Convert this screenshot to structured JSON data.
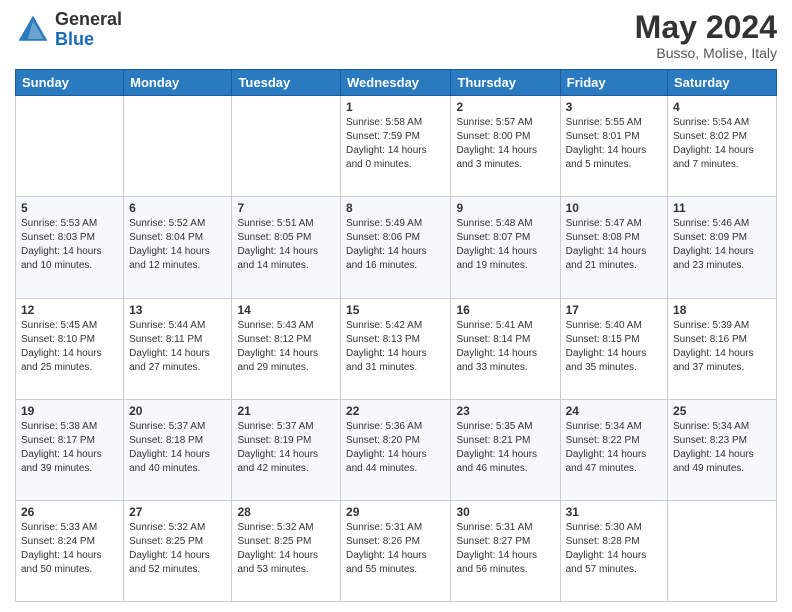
{
  "logo": {
    "general": "General",
    "blue": "Blue"
  },
  "header": {
    "month": "May 2024",
    "location": "Busso, Molise, Italy"
  },
  "days_of_week": [
    "Sunday",
    "Monday",
    "Tuesday",
    "Wednesday",
    "Thursday",
    "Friday",
    "Saturday"
  ],
  "weeks": [
    [
      {
        "day": "",
        "info": ""
      },
      {
        "day": "",
        "info": ""
      },
      {
        "day": "",
        "info": ""
      },
      {
        "day": "1",
        "info": "Sunrise: 5:58 AM\nSunset: 7:59 PM\nDaylight: 14 hours\nand 0 minutes."
      },
      {
        "day": "2",
        "info": "Sunrise: 5:57 AM\nSunset: 8:00 PM\nDaylight: 14 hours\nand 3 minutes."
      },
      {
        "day": "3",
        "info": "Sunrise: 5:55 AM\nSunset: 8:01 PM\nDaylight: 14 hours\nand 5 minutes."
      },
      {
        "day": "4",
        "info": "Sunrise: 5:54 AM\nSunset: 8:02 PM\nDaylight: 14 hours\nand 7 minutes."
      }
    ],
    [
      {
        "day": "5",
        "info": "Sunrise: 5:53 AM\nSunset: 8:03 PM\nDaylight: 14 hours\nand 10 minutes."
      },
      {
        "day": "6",
        "info": "Sunrise: 5:52 AM\nSunset: 8:04 PM\nDaylight: 14 hours\nand 12 minutes."
      },
      {
        "day": "7",
        "info": "Sunrise: 5:51 AM\nSunset: 8:05 PM\nDaylight: 14 hours\nand 14 minutes."
      },
      {
        "day": "8",
        "info": "Sunrise: 5:49 AM\nSunset: 8:06 PM\nDaylight: 14 hours\nand 16 minutes."
      },
      {
        "day": "9",
        "info": "Sunrise: 5:48 AM\nSunset: 8:07 PM\nDaylight: 14 hours\nand 19 minutes."
      },
      {
        "day": "10",
        "info": "Sunrise: 5:47 AM\nSunset: 8:08 PM\nDaylight: 14 hours\nand 21 minutes."
      },
      {
        "day": "11",
        "info": "Sunrise: 5:46 AM\nSunset: 8:09 PM\nDaylight: 14 hours\nand 23 minutes."
      }
    ],
    [
      {
        "day": "12",
        "info": "Sunrise: 5:45 AM\nSunset: 8:10 PM\nDaylight: 14 hours\nand 25 minutes."
      },
      {
        "day": "13",
        "info": "Sunrise: 5:44 AM\nSunset: 8:11 PM\nDaylight: 14 hours\nand 27 minutes."
      },
      {
        "day": "14",
        "info": "Sunrise: 5:43 AM\nSunset: 8:12 PM\nDaylight: 14 hours\nand 29 minutes."
      },
      {
        "day": "15",
        "info": "Sunrise: 5:42 AM\nSunset: 8:13 PM\nDaylight: 14 hours\nand 31 minutes."
      },
      {
        "day": "16",
        "info": "Sunrise: 5:41 AM\nSunset: 8:14 PM\nDaylight: 14 hours\nand 33 minutes."
      },
      {
        "day": "17",
        "info": "Sunrise: 5:40 AM\nSunset: 8:15 PM\nDaylight: 14 hours\nand 35 minutes."
      },
      {
        "day": "18",
        "info": "Sunrise: 5:39 AM\nSunset: 8:16 PM\nDaylight: 14 hours\nand 37 minutes."
      }
    ],
    [
      {
        "day": "19",
        "info": "Sunrise: 5:38 AM\nSunset: 8:17 PM\nDaylight: 14 hours\nand 39 minutes."
      },
      {
        "day": "20",
        "info": "Sunrise: 5:37 AM\nSunset: 8:18 PM\nDaylight: 14 hours\nand 40 minutes."
      },
      {
        "day": "21",
        "info": "Sunrise: 5:37 AM\nSunset: 8:19 PM\nDaylight: 14 hours\nand 42 minutes."
      },
      {
        "day": "22",
        "info": "Sunrise: 5:36 AM\nSunset: 8:20 PM\nDaylight: 14 hours\nand 44 minutes."
      },
      {
        "day": "23",
        "info": "Sunrise: 5:35 AM\nSunset: 8:21 PM\nDaylight: 14 hours\nand 46 minutes."
      },
      {
        "day": "24",
        "info": "Sunrise: 5:34 AM\nSunset: 8:22 PM\nDaylight: 14 hours\nand 47 minutes."
      },
      {
        "day": "25",
        "info": "Sunrise: 5:34 AM\nSunset: 8:23 PM\nDaylight: 14 hours\nand 49 minutes."
      }
    ],
    [
      {
        "day": "26",
        "info": "Sunrise: 5:33 AM\nSunset: 8:24 PM\nDaylight: 14 hours\nand 50 minutes."
      },
      {
        "day": "27",
        "info": "Sunrise: 5:32 AM\nSunset: 8:25 PM\nDaylight: 14 hours\nand 52 minutes."
      },
      {
        "day": "28",
        "info": "Sunrise: 5:32 AM\nSunset: 8:25 PM\nDaylight: 14 hours\nand 53 minutes."
      },
      {
        "day": "29",
        "info": "Sunrise: 5:31 AM\nSunset: 8:26 PM\nDaylight: 14 hours\nand 55 minutes."
      },
      {
        "day": "30",
        "info": "Sunrise: 5:31 AM\nSunset: 8:27 PM\nDaylight: 14 hours\nand 56 minutes."
      },
      {
        "day": "31",
        "info": "Sunrise: 5:30 AM\nSunset: 8:28 PM\nDaylight: 14 hours\nand 57 minutes."
      },
      {
        "day": "",
        "info": ""
      }
    ]
  ]
}
